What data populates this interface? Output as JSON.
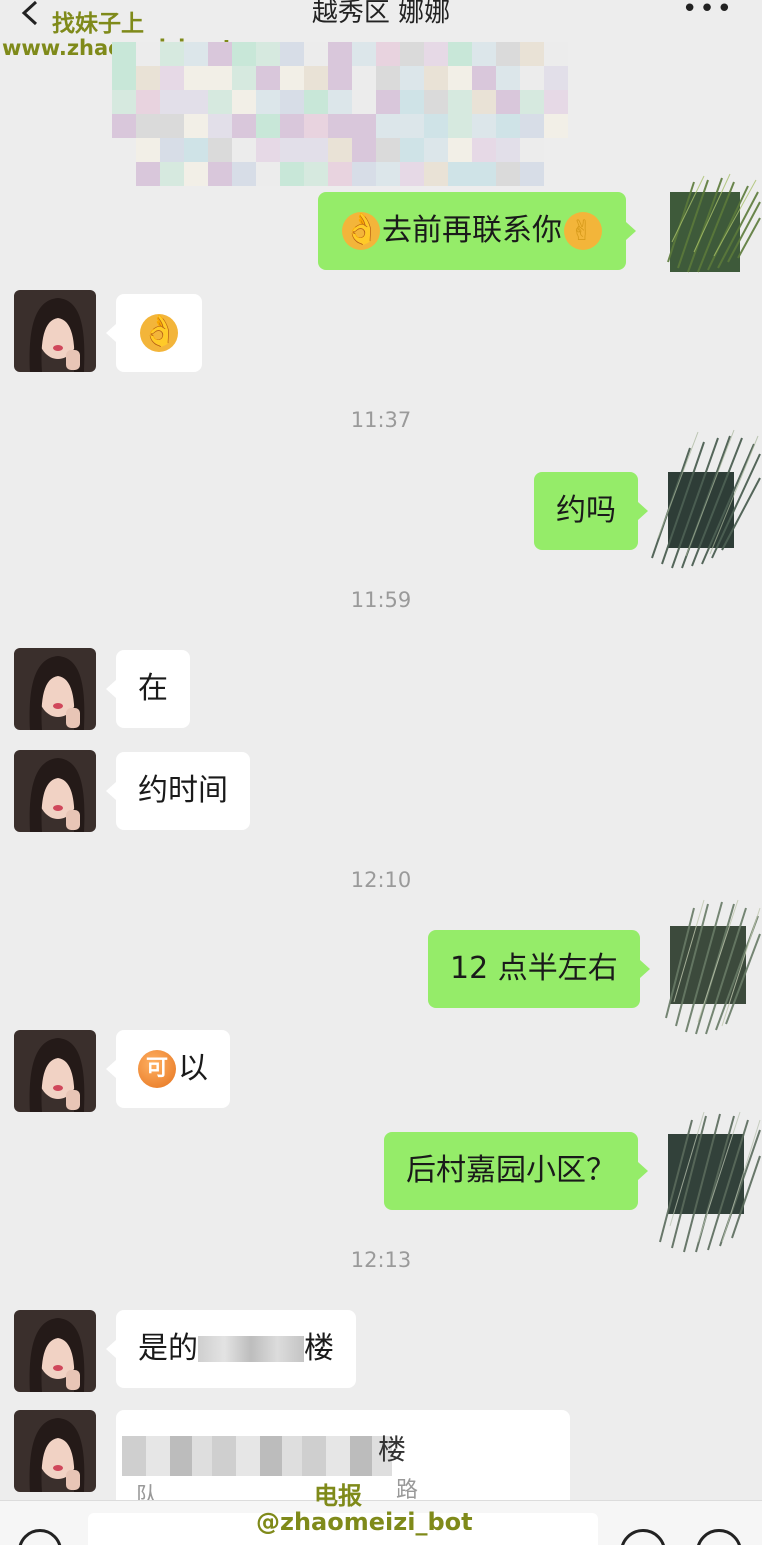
{
  "header": {
    "title": "越秀区 娜娜",
    "more": "•••"
  },
  "watermark": {
    "site_name": "找妹子上",
    "site_url": "www.zhaomeizi.net",
    "telegram_label": "电报",
    "telegram_handle": "@zhaomeizi_bot"
  },
  "messages": [
    {
      "side": "right",
      "text": "去前再联系你",
      "emoji_before": "ok-hand",
      "emoji_after": "victory-hand"
    },
    {
      "side": "left",
      "text": "",
      "emoji": "ok-hand"
    },
    {
      "timestamp": "11:37"
    },
    {
      "side": "right",
      "text": "约吗"
    },
    {
      "timestamp": "11:59"
    },
    {
      "side": "left",
      "text": "在"
    },
    {
      "side": "left",
      "text": "约时间"
    },
    {
      "timestamp": "12:10"
    },
    {
      "side": "right",
      "text": "12 点半左右"
    },
    {
      "side": "left",
      "text": "以",
      "emoji": "可-coin"
    },
    {
      "side": "right",
      "text": "后村嘉园小区？"
    },
    {
      "timestamp": "12:13"
    },
    {
      "side": "left",
      "text_prefix": "是的",
      "text_suffix": "楼"
    },
    {
      "side": "left",
      "fragments": [
        "楼",
        "路",
        "队"
      ]
    }
  ],
  "m": {
    "msg1": "去前再联系你",
    "ts1": "11:37",
    "msg3": "约吗",
    "ts2": "11:59",
    "msg4": "在",
    "msg5": "约时间",
    "ts3": "12:10",
    "msg6": "12 点半左右",
    "coin_char": "可",
    "msg7": "以",
    "msg8": "后村嘉园小区？",
    "ts4": "12:13",
    "msg9_prefix": "是的",
    "msg9_suffix": "楼",
    "frag1": "楼",
    "frag2": "路",
    "frag3": "队"
  },
  "colors": {
    "background": "#ededed",
    "bubble_right": "#95ec69",
    "bubble_left": "#ffffff",
    "watermark": "#7f8a1a"
  }
}
